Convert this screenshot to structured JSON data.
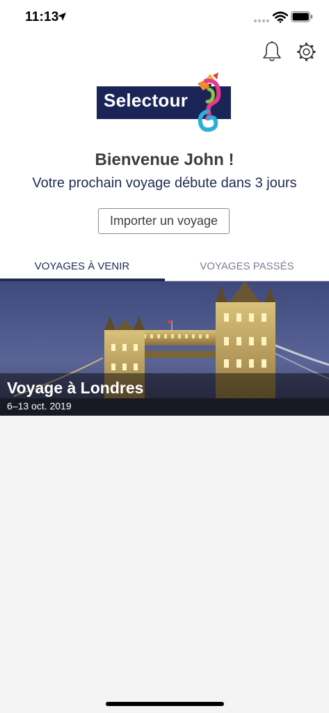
{
  "status_bar": {
    "time": "11:13"
  },
  "header": {
    "notifications_icon": "bell-icon",
    "settings_icon": "gear-icon"
  },
  "brand": {
    "logo_text": "Selectour",
    "logo_bg_color": "#1b2457"
  },
  "welcome": {
    "title": "Bienvenue John !",
    "subtitle": "Votre prochain voyage débute dans 3 jours"
  },
  "actions": {
    "import_label": "Importer un voyage"
  },
  "tabs": [
    {
      "label": "VOYAGES À VENIR",
      "active": true
    },
    {
      "label": "VOYAGES PASSÉS",
      "active": false
    }
  ],
  "trips": [
    {
      "title": "Voyage à Londres",
      "dates": "6–13 oct. 2019"
    }
  ],
  "colors": {
    "primary": "#1e2a52",
    "page_background": "#f4f4f4"
  }
}
